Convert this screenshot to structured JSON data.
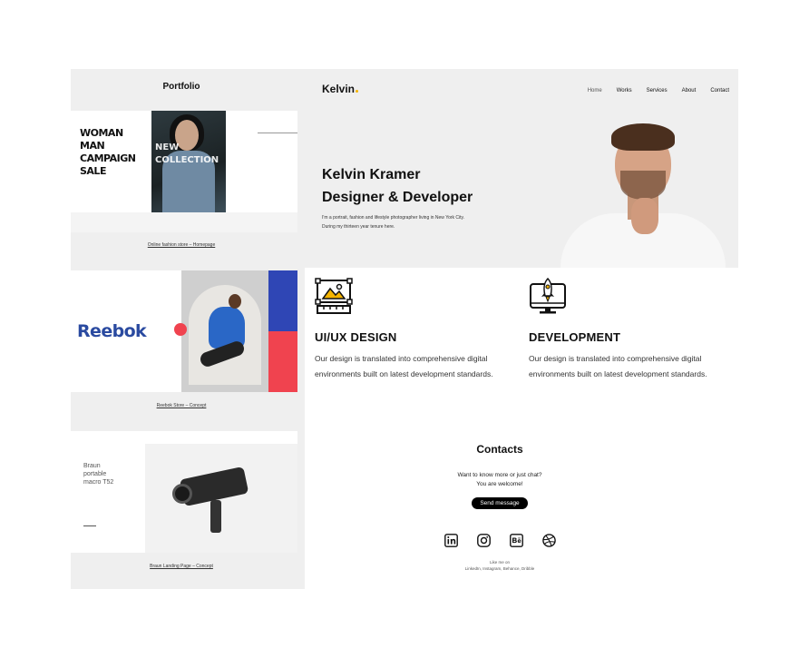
{
  "portfolio": {
    "title": "Portfolio",
    "thumb1": {
      "big_text": "WOMAN MAN CAMPAIGN SALE",
      "overlay_text": "NEW COLLECTION",
      "caption": "Online fashion store – Homepage"
    },
    "thumb2": {
      "logo": "Reebok",
      "caption": "Reebok Store – Concept"
    },
    "thumb3": {
      "product_text": "Braun portable macro T52",
      "caption": "Braun Landing Page – Concept"
    }
  },
  "header": {
    "brand": "Kelvin",
    "nav": [
      "Home",
      "Works",
      "Services",
      "About",
      "Contact"
    ]
  },
  "hero": {
    "headline_line1": "Kelvin Kramer",
    "headline_line2": "Designer & Developer",
    "sub_line1": "I'm a portrait, fashion and lifestyle photographer living in New York City.",
    "sub_line2": "During my thirteen year tenure here."
  },
  "services": [
    {
      "title": "UI/UX DESIGN",
      "description": "Our design is translated into comprehensive digital environments built on latest development standards.",
      "icon": "design-frame-icon"
    },
    {
      "title": "DEVELOPMENT",
      "description": "Our design is translated into comprehensive digital environments built on latest development standards.",
      "icon": "rocket-monitor-icon"
    }
  ],
  "contacts": {
    "title": "Contacts",
    "ask_line1": "Want to know more or just chat?",
    "ask_line2": "You are welcome!",
    "button": "Send message",
    "socials": [
      "linkedin-icon",
      "instagram-icon",
      "behance-icon",
      "dribbble-icon"
    ],
    "like_line1": "Like me on",
    "like_line2": "LinkedIn, Instagram, Behance, Dribble"
  }
}
